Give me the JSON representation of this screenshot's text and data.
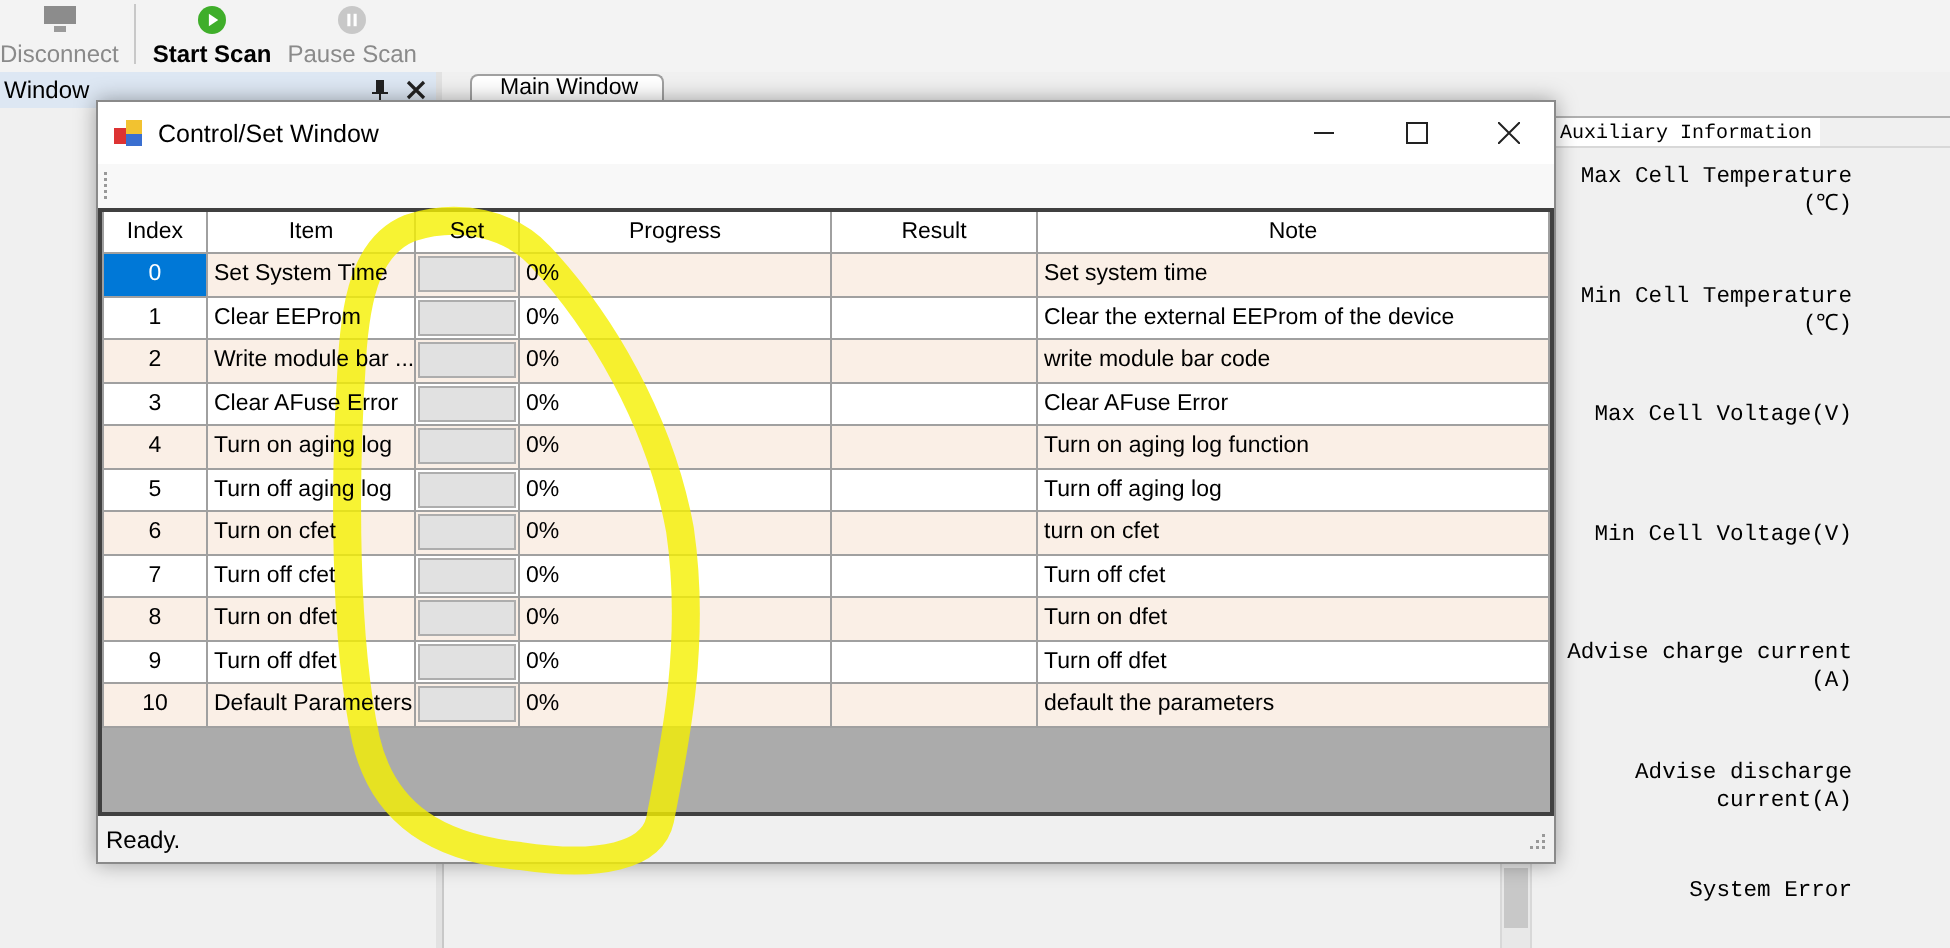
{
  "toolbar": {
    "buttons": [
      {
        "label": "Disconnect",
        "kind": "disconnect",
        "disabled": true
      },
      {
        "label": "Start Scan",
        "kind": "start",
        "disabled": false
      },
      {
        "label": "Pause Scan",
        "kind": "pause",
        "disabled": true
      }
    ]
  },
  "left_panel": {
    "title": "Window"
  },
  "main_tabs": [
    {
      "label": "Main Window",
      "selected": true
    }
  ],
  "right_panel": {
    "tabs": [
      {
        "label": "Auxiliary Information",
        "selected": true
      }
    ],
    "labels": [
      {
        "lines": [
          "Max Cell Temperature",
          "(℃)"
        ]
      },
      {
        "lines": [
          "Min Cell Temperature",
          "(℃)"
        ]
      },
      {
        "lines": [
          "Max Cell Voltage(V)"
        ]
      },
      {
        "lines": [
          "Min Cell Voltage(V)"
        ]
      },
      {
        "lines": [
          "Advise charge current",
          "(A)"
        ]
      },
      {
        "lines": [
          "Advise discharge",
          "current(A)"
        ]
      },
      {
        "lines": [
          "System Error"
        ]
      }
    ]
  },
  "dialog": {
    "title": "Control/Set Window",
    "columns": [
      "Index",
      "Item",
      "Set",
      "Progress",
      "Result",
      "Note"
    ],
    "rows": [
      {
        "index": "0",
        "item": "Set System Time",
        "progress": "0%",
        "note": "Set system time",
        "selected": true
      },
      {
        "index": "1",
        "item": "Clear EEProm",
        "progress": "0%",
        "note": "Clear the external EEProm of the device",
        "selected": false
      },
      {
        "index": "2",
        "item": "Write module bar ...",
        "progress": "0%",
        "note": "write module bar code",
        "selected": false
      },
      {
        "index": "3",
        "item": "Clear AFuse Error",
        "progress": "0%",
        "note": "Clear AFuse Error",
        "selected": false
      },
      {
        "index": "4",
        "item": "Turn on aging log",
        "progress": "0%",
        "note": "Turn on aging log function",
        "selected": false
      },
      {
        "index": "5",
        "item": "Turn off aging log",
        "progress": "0%",
        "note": "Turn off aging log",
        "selected": false
      },
      {
        "index": "6",
        "item": "Turn on cfet",
        "progress": "0%",
        "note": "turn on cfet",
        "selected": false
      },
      {
        "index": "7",
        "item": "Turn off cfet",
        "progress": "0%",
        "note": "Turn off cfet",
        "selected": false
      },
      {
        "index": "8",
        "item": "Turn on dfet",
        "progress": "0%",
        "note": "Turn on dfet",
        "selected": false
      },
      {
        "index": "9",
        "item": "Turn off dfet",
        "progress": "0%",
        "note": "Turn off dfet",
        "selected": false
      },
      {
        "index": "10",
        "item": "Default Parameters",
        "progress": "0%",
        "note": "default the parameters",
        "selected": false
      }
    ],
    "status": "Ready."
  }
}
